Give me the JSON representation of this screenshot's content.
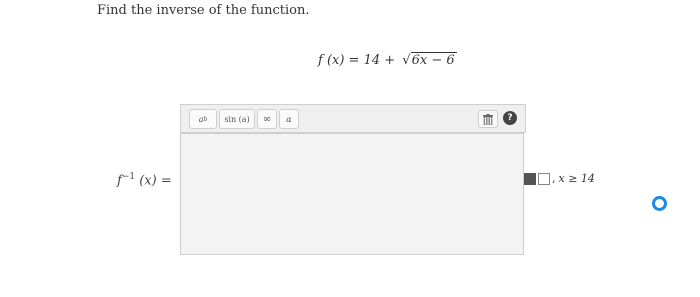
{
  "question": {
    "prompt": "Find the inverse of the function.",
    "function_lhs": "f (x) = 14 +",
    "sqrt_symbol": "√",
    "radicand": "6x − 6"
  },
  "toolbar": {
    "power_label": "a",
    "power_sup": "b",
    "sin_label": "sin (a)",
    "infinity_label": "∞",
    "alpha_label": "α",
    "trash_icon": "trash-icon",
    "help_label": "?"
  },
  "answer": {
    "label_f": "f",
    "label_sup": "−1",
    "label_rest": " (x) =",
    "value": ""
  },
  "domain": {
    "separator": ",",
    "condition": "x ≥ 14"
  },
  "colors": {
    "radio": "#1e88e5"
  }
}
